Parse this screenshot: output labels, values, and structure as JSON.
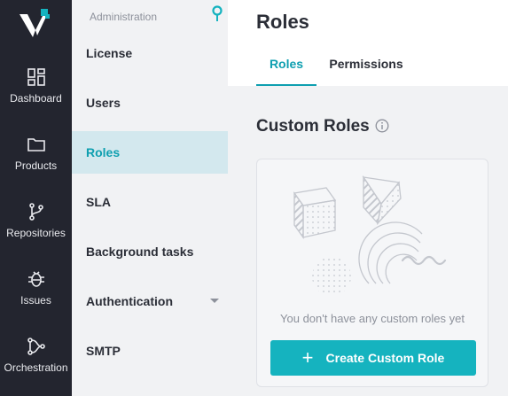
{
  "rail": {
    "items": [
      {
        "label": "Dashboard",
        "icon": "dashboard-icon"
      },
      {
        "label": "Products",
        "icon": "folder-icon"
      },
      {
        "label": "Repositories",
        "icon": "branch-icon"
      },
      {
        "label": "Issues",
        "icon": "bug-icon"
      },
      {
        "label": "Orchestration",
        "icon": "orchestration-icon"
      }
    ]
  },
  "subnav": {
    "header": "Administration",
    "items": [
      {
        "label": "License"
      },
      {
        "label": "Users"
      },
      {
        "label": "Roles"
      },
      {
        "label": "SLA"
      },
      {
        "label": "Background tasks"
      },
      {
        "label": "Authentication"
      },
      {
        "label": "SMTP"
      }
    ]
  },
  "main": {
    "title": "Roles",
    "tabs": [
      {
        "label": "Roles"
      },
      {
        "label": "Permissions"
      }
    ],
    "section_title": "Custom Roles",
    "empty_text": "You don't have any custom roles yet",
    "create_button": "Create Custom Role"
  },
  "colors": {
    "accent": "#0e9fb0",
    "button": "#15b3bf",
    "rail_bg": "#23252f",
    "active_bg": "#d3e8ee"
  }
}
